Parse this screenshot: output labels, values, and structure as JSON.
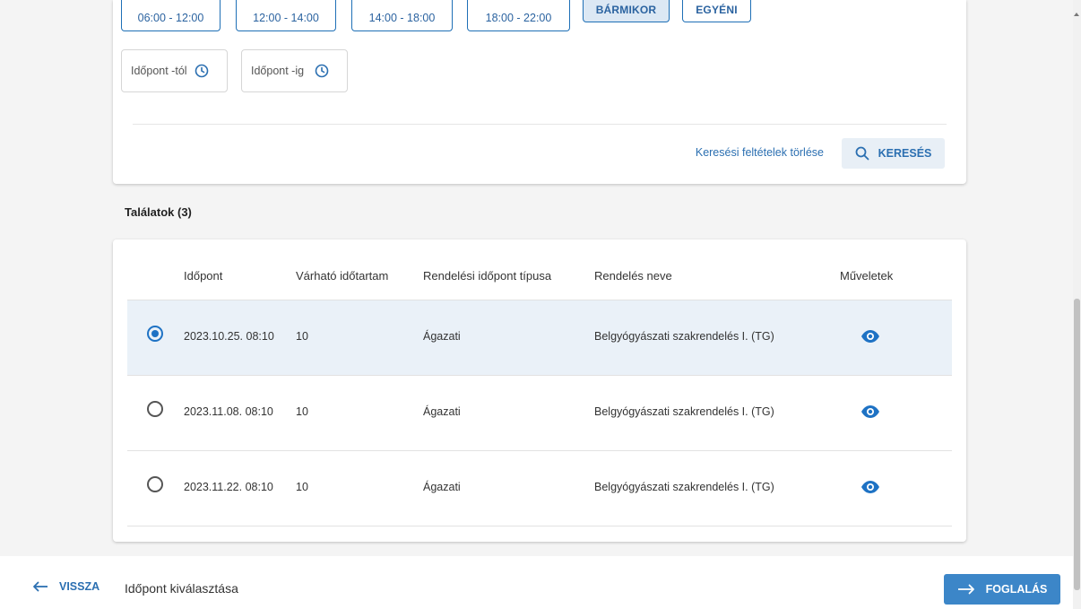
{
  "filters": {
    "chips": [
      {
        "label": "06:00 - 12:00",
        "active": false
      },
      {
        "label": "12:00 - 14:00",
        "active": false
      },
      {
        "label": "14:00 - 18:00",
        "active": false
      },
      {
        "label": "18:00 - 22:00",
        "active": false
      },
      {
        "label": "BÁRMIKOR",
        "active": true
      },
      {
        "label": "EGYÉNI",
        "active": false
      }
    ],
    "from_label": "Időpont -tól",
    "to_label": "Időpont -ig",
    "clear_label": "Keresési feltételek törlése",
    "search_label": "KERESÉS"
  },
  "results": {
    "title": "Találatok (3)",
    "headers": [
      "Időpont",
      "Várható időtartam",
      "Rendelési időpont típusa",
      "Rendelés neve",
      "Műveletek"
    ],
    "rows": [
      {
        "selected": true,
        "datetime": "2023.10.25. 08:10",
        "duration": "10",
        "type": "Ágazati",
        "name": "Belgyógyászati szakrendelés I. (TG)"
      },
      {
        "selected": false,
        "datetime": "2023.11.08. 08:10",
        "duration": "10",
        "type": "Ágazati",
        "name": "Belgyógyászati szakrendelés I. (TG)"
      },
      {
        "selected": false,
        "datetime": "2023.11.22. 08:10",
        "duration": "10",
        "type": "Ágazati",
        "name": "Belgyógyászati szakrendelés I. (TG)"
      }
    ]
  },
  "footer": {
    "back_label": "VISSZA",
    "step_title": "Időpont kiválasztása",
    "book_label": "FOGLALÁS"
  },
  "colors": {
    "accent": "#1e72c4",
    "primary_button": "#3c86c8",
    "selected_row": "#eaf1f8"
  },
  "icons": {
    "clock": "clock-icon",
    "search": "search-icon",
    "view": "eye-icon",
    "back": "arrow-left-icon",
    "forward": "arrow-right-icon"
  }
}
